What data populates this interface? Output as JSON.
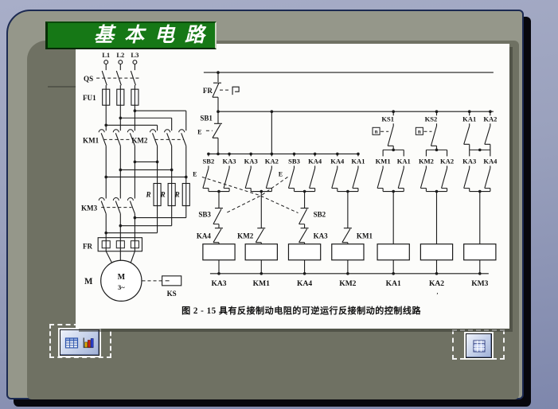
{
  "slide": {
    "title": "基本电路",
    "caption": "图 2 - 15  具有反接制动电阻的可逆运行反接制动的控制线路"
  },
  "colors": {
    "banner_green": "#167816",
    "slide_frame": "#95978a",
    "slide_inner": "#6f7163",
    "page_background": "#9aa1bd",
    "ink": "#1b1b1b",
    "panel_white": "#fcfcfa"
  },
  "power": {
    "phases": [
      "L1",
      "L2",
      "L3"
    ],
    "disconnect": "QS",
    "fuse": "FU1",
    "contactor_forward": "KM1",
    "contactor_reverse": "KM2",
    "contactor_brake": "KM3",
    "resistor": "R",
    "overload_relay": "FR",
    "motor": "M",
    "motor_inner": "M",
    "motor_phases": "3~",
    "speed_relay": "KS"
  },
  "control": {
    "overload_contact": "FR",
    "stop_button": "SB1",
    "pushbutton_symbol": "E",
    "speed_symbol": "n",
    "row_contacts": [
      "SB2",
      "KA3",
      "KA3",
      "KA2",
      "SB3",
      "KA4",
      "KA4",
      "KA1",
      "KM1",
      "KA1",
      "KM2",
      "KA2",
      "KA3",
      "KA4"
    ],
    "upper_contacts": [
      "KS1",
      "KS2",
      "KA1",
      "KA2"
    ],
    "interlock_buttons": [
      "SB3",
      "SB2"
    ],
    "interlock_contacts": [
      "KA4",
      "KM2",
      "KA3",
      "KM1"
    ],
    "coil_labels": [
      "KA3",
      "KM1",
      "KA4",
      "KM2",
      "KA1",
      "KA2",
      "KM3"
    ],
    "stray_mark": ","
  },
  "footer": {
    "left_placeholder_icons": [
      "table-icon",
      "bar-chart-icon"
    ],
    "right_placeholder_icons": [
      "table-icon"
    ]
  }
}
